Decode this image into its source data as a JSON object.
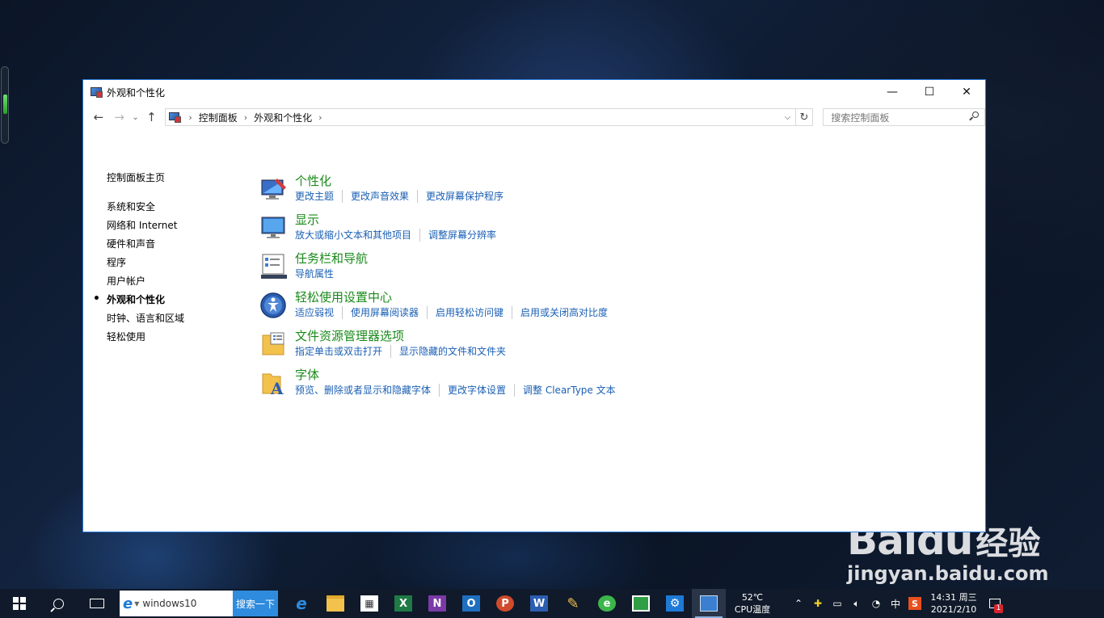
{
  "window": {
    "title": "外观和个性化",
    "controls": {
      "minimize": "—",
      "maximize": "☐",
      "close": "✕"
    }
  },
  "addressbar": {
    "breadcrumbs": [
      "控制面板",
      "外观和个性化"
    ],
    "search_placeholder": "搜索控制面板"
  },
  "leftnav": {
    "home": "控制面板主页",
    "items": [
      {
        "label": "系统和安全",
        "active": false
      },
      {
        "label": "网络和 Internet",
        "active": false
      },
      {
        "label": "硬件和声音",
        "active": false
      },
      {
        "label": "程序",
        "active": false
      },
      {
        "label": "用户帐户",
        "active": false
      },
      {
        "label": "外观和个性化",
        "active": true
      },
      {
        "label": "时钟、语言和区域",
        "active": false
      },
      {
        "label": "轻松使用",
        "active": false
      }
    ]
  },
  "categories": [
    {
      "title": "个性化",
      "icon": "personalization-icon",
      "links": [
        "更改主题",
        "更改声音效果",
        "更改屏幕保护程序"
      ]
    },
    {
      "title": "显示",
      "icon": "display-icon",
      "links": [
        "放大或缩小文本和其他项目",
        "调整屏幕分辨率"
      ]
    },
    {
      "title": "任务栏和导航",
      "icon": "taskbar-icon",
      "links": [
        "导航属性"
      ]
    },
    {
      "title": "轻松使用设置中心",
      "icon": "ease-of-access-icon",
      "links": [
        "适应弱视",
        "使用屏幕阅读器",
        "启用轻松访问键",
        "启用或关闭高对比度"
      ]
    },
    {
      "title": "文件资源管理器选项",
      "icon": "folder-options-icon",
      "links": [
        "指定单击或双击打开",
        "显示隐藏的文件和文件夹"
      ]
    },
    {
      "title": "字体",
      "icon": "fonts-icon",
      "links": [
        "预览、删除或者显示和隐藏字体",
        "更改字体设置",
        "调整 ClearType 文本"
      ]
    }
  ],
  "taskbar": {
    "ie_search_value": "windows10",
    "ie_search_button": "搜索一下",
    "temperature": "52℃",
    "temperature_label": "CPU温度",
    "ime_label": "中",
    "clock_time": "14:31 周三",
    "clock_date": "2021/2/10",
    "notification_count": "1"
  },
  "watermark": {
    "brand": "Bai",
    "brand_suffix": "du",
    "brand_cn": "经验",
    "site": "jingyan.baidu.com"
  },
  "colors": {
    "category_title": "#1a8a1a",
    "link": "#1a5fb4",
    "window_border": "#2b79d8",
    "taskbar": "#101a2a"
  }
}
